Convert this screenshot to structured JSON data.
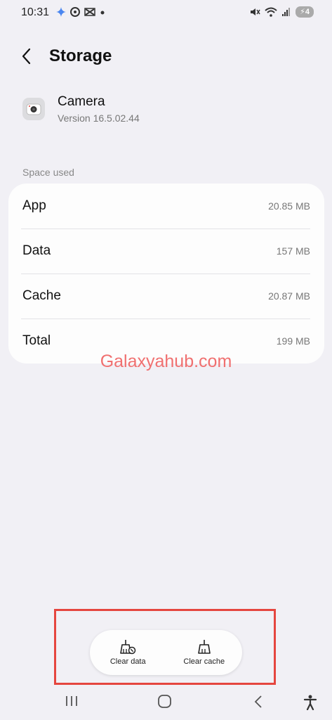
{
  "status": {
    "time": "10:31",
    "battery": "4",
    "left_icons": [
      "gemini-icon",
      "camera-shutter-icon",
      "capcut-icon",
      "dot-icon"
    ],
    "right_icons": [
      "mute-icon",
      "wifi-icon",
      "signal-icon",
      "battery-icon"
    ]
  },
  "header": {
    "title": "Storage"
  },
  "app": {
    "name": "Camera",
    "version": "Version 16.5.02.44"
  },
  "space_used": {
    "label": "Space used",
    "rows": [
      {
        "label": "App",
        "value": "20.85 MB"
      },
      {
        "label": "Data",
        "value": "157 MB"
      },
      {
        "label": "Cache",
        "value": "20.87 MB"
      },
      {
        "label": "Total",
        "value": "199 MB"
      }
    ]
  },
  "watermark": "Galaxyahub.com",
  "actions": {
    "clear_data": "Clear data",
    "clear_cache": "Clear cache"
  },
  "colors": {
    "highlight": "#e5463f",
    "background": "#f1f0f5",
    "watermark": "#f07070"
  },
  "nav": [
    "recents-icon",
    "home-icon",
    "back-icon",
    "accessibility-icon"
  ]
}
